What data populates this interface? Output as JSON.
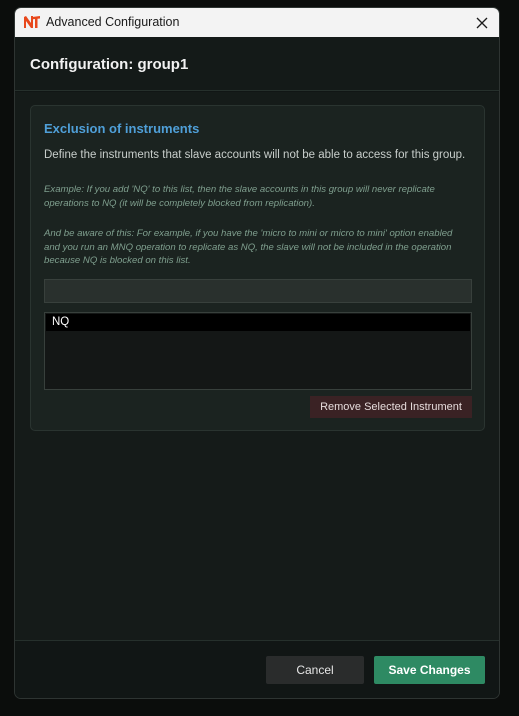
{
  "window": {
    "title": "Advanced Configuration",
    "logo_icon": "nt-logo-icon",
    "close_icon": "close-icon"
  },
  "header": {
    "title": "Configuration: group1"
  },
  "exclusion": {
    "title": "Exclusion of instruments",
    "description": "Define the instruments that slave accounts will not be able to access for this group.",
    "example": "Example: If you add 'NQ' to this list, then the slave accounts in this group will never replicate operations to NQ (it will be completely blocked from replication).",
    "warning": "And be aware of this: For example, if you have the 'micro to mini or micro to mini' option enabled and you run an MNQ operation to replicate as NQ, the slave will not be included in the operation because NQ is blocked on this list.",
    "input_value": "",
    "instruments": [
      "NQ"
    ],
    "remove_label": "Remove Selected Instrument"
  },
  "footer": {
    "cancel_label": "Cancel",
    "save_label": "Save Changes"
  },
  "colors": {
    "accent_blue": "#4f9fd8",
    "save_green": "#2e8a63",
    "remove_red": "#3a2224",
    "logo_orange": "#e8481c"
  }
}
